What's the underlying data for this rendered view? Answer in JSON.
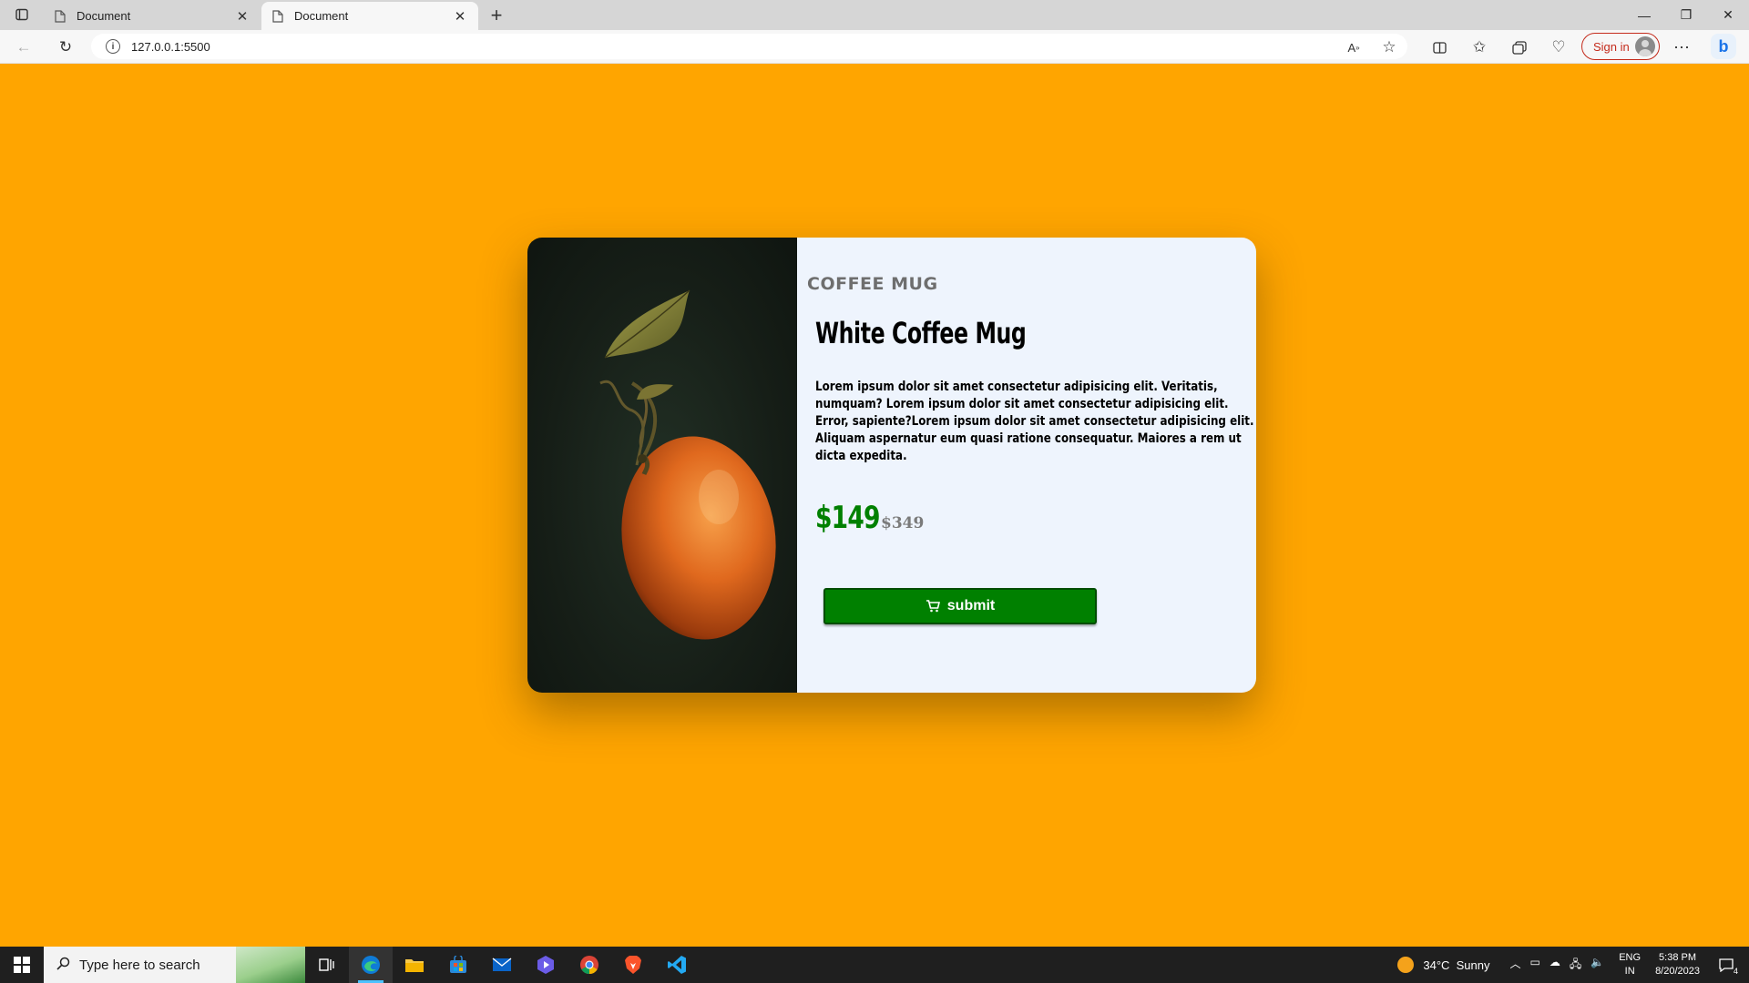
{
  "browser": {
    "tabs": [
      {
        "title": "Document",
        "active": false
      },
      {
        "title": "Document",
        "active": true
      }
    ],
    "url": "127.0.0.1:5500",
    "sign_in_label": "Sign in"
  },
  "product": {
    "category": "COFFEE MUG",
    "title": "White Coffee Mug",
    "description": "Lorem ipsum dolor sit amet consectetur adipisicing elit. Veritatis, numquam? Lorem ipsum dolor sit amet consectetur adipisicing elit. Error, sapiente?Lorem ipsum dolor sit amet consectetur adipisicing elit. Aliquam aspernatur eum quasi ratione consequatur. Maiores a rem ut dicta expedita.",
    "price": "$149",
    "old_price": "$349",
    "button_label": "submit",
    "image_icon": "orange-fruit-image"
  },
  "colors": {
    "page_background": "#ffa500",
    "panel_background": "#eef4fd",
    "price": "#008000",
    "button": "#008000"
  },
  "taskbar": {
    "search_placeholder": "Type here to search",
    "weather_temp": "34°C",
    "weather_text": "Sunny",
    "lang_line1": "ENG",
    "lang_line2": "IN",
    "time": "5:38 PM",
    "date": "8/20/2023",
    "notification_count": "4"
  }
}
